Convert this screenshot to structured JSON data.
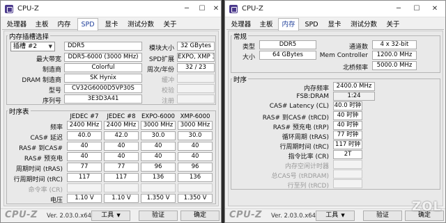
{
  "left": {
    "title": "CPU-Z",
    "tabs": [
      "处理器",
      "主板",
      "内存",
      "SPD",
      "显卡",
      "测试分数",
      "关于"
    ],
    "active_tab": "SPD",
    "slot_group": {
      "title": "内存插槽选择",
      "slot_value": "插槽 #2",
      "type_value": "DDR5",
      "module_size_label": "模块大小",
      "module_size_value": "32 GBytes",
      "bandwidth_label": "最大带宽",
      "bandwidth_value": "DDR5-6000 (3000 MHz)",
      "spd_ext_label": "SPD扩展",
      "spd_ext_value": "EXPO, XMP 3.0",
      "manufacturer_label": "制造商",
      "manufacturer_value": "Colorful",
      "week_year_label": "周次/年份",
      "week_year_value": "32 / 23",
      "dram_mfr_label": "DRAM 制造商",
      "dram_mfr_value": "SK Hynix",
      "buffered_label": "缓冲",
      "model_label": "型号",
      "model_value": "CV32G6000D5VP30S",
      "ecc_label": "校验",
      "serial_label": "序列号",
      "serial_value": "3E3D3A41",
      "registered_label": "注册"
    },
    "timing_group": {
      "title": "时序表",
      "columns": [
        "JEDEC #7",
        "JEDEC #8",
        "EXPO-6000",
        "XMP-6000"
      ],
      "rows": [
        {
          "label": "频率",
          "values": [
            "2400 MHz",
            "2400 MHz",
            "3000 MHz",
            "3000 MHz"
          ],
          "dim": false
        },
        {
          "label": "CAS# 延迟",
          "values": [
            "40.0",
            "42.0",
            "30.0",
            "30.0"
          ],
          "dim": false
        },
        {
          "label": "RAS# 到CAS#",
          "values": [
            "40",
            "40",
            "40",
            "40"
          ],
          "dim": false
        },
        {
          "label": "RAS# 预充电",
          "values": [
            "40",
            "40",
            "40",
            "40"
          ],
          "dim": false
        },
        {
          "label": "周期时间 (tRAS)",
          "values": [
            "77",
            "77",
            "96",
            "96"
          ],
          "dim": false
        },
        {
          "label": "行周期时间 (tRC)",
          "values": [
            "117",
            "117",
            "136",
            "136"
          ],
          "dim": false
        },
        {
          "label": "命令率 (CR)",
          "values": [
            "",
            "",
            "",
            ""
          ],
          "dim": true
        },
        {
          "label": "电压",
          "values": [
            "1.10 V",
            "1.10 V",
            "1.350 V",
            "1.350 V"
          ],
          "dim": false
        }
      ]
    },
    "footer": {
      "logo": "CPU-Z",
      "version": "Ver. 2.03.0.x64",
      "tools": "工具",
      "validate": "验证",
      "ok": "确定"
    }
  },
  "right": {
    "title": "CPU-Z",
    "tabs": [
      "处理器",
      "主板",
      "内存",
      "SPD",
      "显卡",
      "测试分数",
      "关于"
    ],
    "active_tab": "内存",
    "general_group": {
      "title": "常规",
      "type_label": "类型",
      "type_value": "DDR5",
      "channels_label": "通道数",
      "channels_value": "4 x 32-bit",
      "size_label": "大小",
      "size_value": "64 GBytes",
      "mem_ctrl_label": "Mem Controller",
      "mem_ctrl_value": "1200.0 MHz",
      "nb_freq_label": "北桥频率",
      "nb_freq_value": "5000.0 MHz"
    },
    "timings_group": {
      "title": "时序",
      "rows": [
        {
          "label": "内存频率",
          "value": "2400.0 MHz",
          "dim": false
        },
        {
          "label": "FSB:DRAM",
          "value": "1:24",
          "dim": false
        },
        {
          "label": "CAS# Latency (CL)",
          "value": "40.0 时钟",
          "dim": false
        },
        {
          "label": "RAS# 到CAS# (tRCD)",
          "value": "40 时钟",
          "dim": false
        },
        {
          "label": "RAS# 预充电 (tRP)",
          "value": "40 时钟",
          "dim": false
        },
        {
          "label": "循环周期 (tRAS)",
          "value": "77 时钟",
          "dim": false
        },
        {
          "label": "行周期时间 (tRC)",
          "value": "117 时钟",
          "dim": false
        },
        {
          "label": "指令比率 (CR)",
          "value": "2T",
          "dim": false
        },
        {
          "label": "内存空闲计时器",
          "value": "",
          "dim": true
        },
        {
          "label": "总CAS号 (tRDRAM)",
          "value": "",
          "dim": true
        },
        {
          "label": "行至列 (tRCD)",
          "value": "",
          "dim": true
        }
      ]
    },
    "footer": {
      "logo": "CPU-Z",
      "version": "Ver. 2.03.0.x64",
      "tools": "工具",
      "validate": "验证",
      "ok": "确定"
    }
  },
  "watermark": "ZOL"
}
